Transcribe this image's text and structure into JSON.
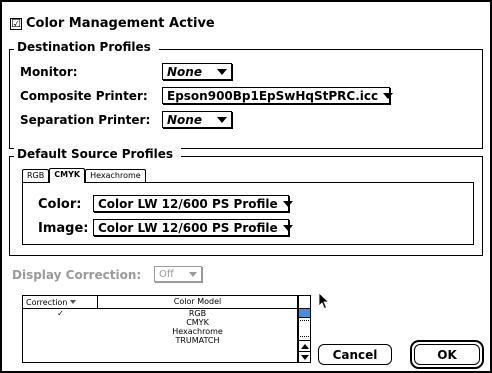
{
  "dialog": {
    "color_management": {
      "label": "Color Management Active",
      "checked": true,
      "check_glyph": "☑"
    },
    "destination": {
      "title": "Destination Profiles",
      "monitor": {
        "label": "Monitor:",
        "value": "None"
      },
      "composite": {
        "label": "Composite Printer:",
        "value": "Epson900Bp1EpSwHqStPRC.icc"
      },
      "separation": {
        "label": "Separation Printer:",
        "value": "None"
      }
    },
    "source": {
      "title": "Default Source Profiles",
      "tabs": [
        {
          "label": "RGB",
          "active": false
        },
        {
          "label": "CMYK",
          "active": true
        },
        {
          "label": "Hexachrome",
          "active": false
        }
      ],
      "color": {
        "label": "Color:",
        "value": "Color LW 12/600 PS Profile"
      },
      "image": {
        "label": "Image:",
        "value": "Color LW 12/600 PS Profile"
      }
    },
    "display_correction": {
      "label": "Display Correction:",
      "value": "Off",
      "enabled": false
    },
    "table": {
      "columns": [
        "Correction",
        "Color Model"
      ],
      "rows": [
        {
          "correction": "✓",
          "model": "RGB"
        },
        {
          "correction": "",
          "model": "CMYK"
        },
        {
          "correction": "",
          "model": "Hexachrome"
        },
        {
          "correction": "",
          "model": "TRUMATCH"
        }
      ]
    },
    "buttons": {
      "cancel": "Cancel",
      "ok": "OK"
    },
    "colors": {
      "scroll_thumb": "#4a8fd6",
      "disabled": "#9a9a9a"
    }
  }
}
